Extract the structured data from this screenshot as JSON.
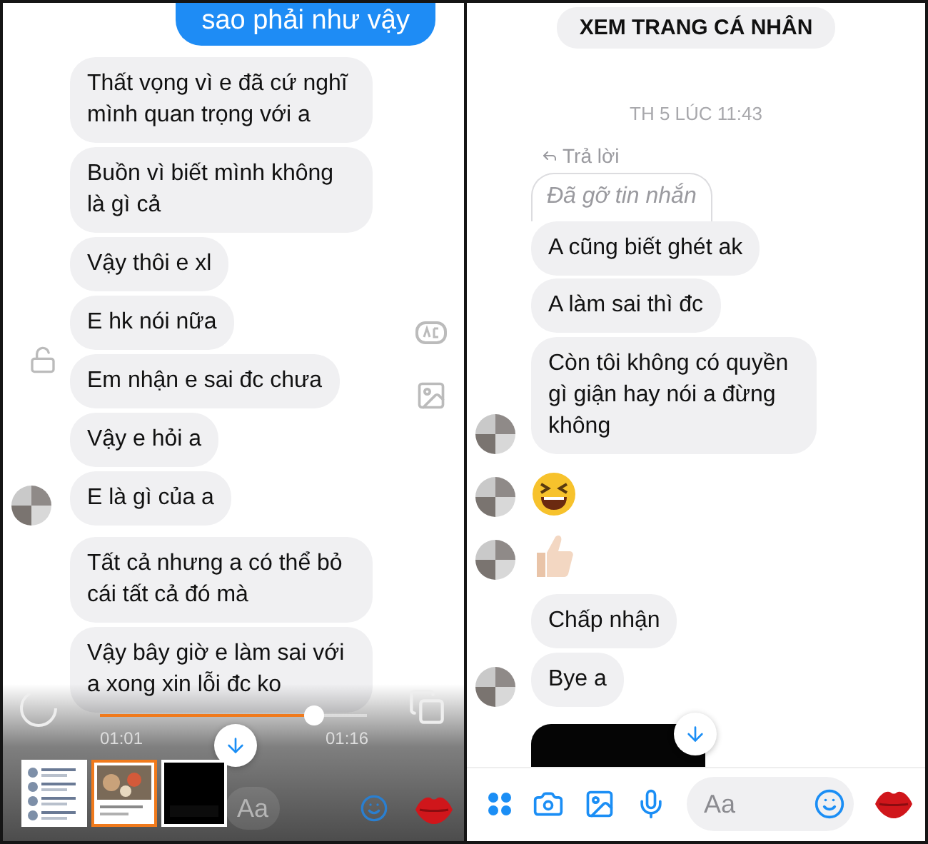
{
  "left_panel": {
    "messages": [
      {
        "kind": "outgoing",
        "text": "sao phải như vậy"
      },
      {
        "kind": "incoming",
        "text": "Thất vọng vì e đã cứ nghĩ mình quan trọng với a",
        "show_avatar": false
      },
      {
        "kind": "incoming",
        "text": "Buồn vì biết mình không là gì cả",
        "show_avatar": false
      },
      {
        "kind": "incoming",
        "text": "Vậy thôi e xl",
        "show_avatar": false
      },
      {
        "kind": "incoming",
        "text": "E hk nói nữa",
        "show_avatar": false
      },
      {
        "kind": "incoming",
        "text": "Em nhận e sai đc chưa",
        "show_avatar": false
      },
      {
        "kind": "incoming",
        "text": "Vậy e hỏi a",
        "show_avatar": false
      },
      {
        "kind": "incoming",
        "text": "E là gì của a",
        "show_avatar": true
      },
      {
        "kind": "incoming",
        "text": "Tất cả nhưng a có thể bỏ cái tất cả đó mà",
        "show_avatar": false
      },
      {
        "kind": "incoming",
        "text": "Vậy bây giờ e làm sai với a xong xin lỗi đc ko",
        "show_avatar": false
      }
    ],
    "video_player": {
      "elapsed": "01:01",
      "duration": "01:16",
      "level": 0.8
    },
    "thumbnails": [
      {
        "kind": "list",
        "selected": false
      },
      {
        "kind": "food",
        "selected": true
      },
      {
        "kind": "dark",
        "selected": false
      }
    ],
    "composer": {
      "placeholder": "Aa"
    }
  },
  "right_panel": {
    "profile_button": "XEM TRANG CÁ NHÂN",
    "timestamp": "TH 5 LÚC 11:43",
    "reply_label": "Trả lời",
    "messages": [
      {
        "kind": "removed",
        "text": "Đã gỡ tin nhắn",
        "show_avatar": false
      },
      {
        "kind": "incoming",
        "text": "A cũng biết ghét ak",
        "show_avatar": false
      },
      {
        "kind": "incoming",
        "text": "A làm sai thì đc",
        "show_avatar": false
      },
      {
        "kind": "incoming",
        "text": "Còn tôi không có quyền gì giận hay nói a đừng không",
        "show_avatar": true
      },
      {
        "kind": "laugh",
        "show_avatar": true
      },
      {
        "kind": "thumbs-up",
        "show_avatar": true
      },
      {
        "kind": "incoming",
        "text": "Chấp nhận",
        "show_avatar": false
      },
      {
        "kind": "incoming",
        "text": "Bye a",
        "show_avatar": true
      },
      {
        "kind": "dark-image",
        "show_avatar": false
      }
    ],
    "composer": {
      "placeholder": "Aa"
    }
  }
}
